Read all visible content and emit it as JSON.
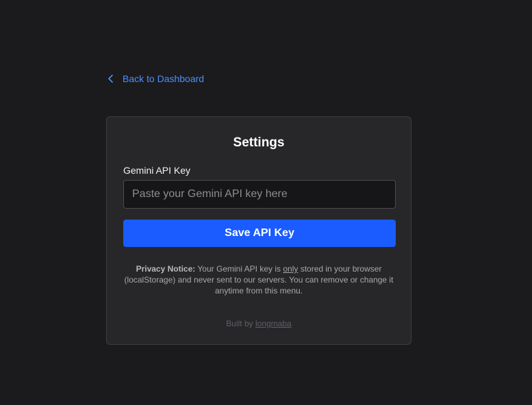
{
  "nav": {
    "back_label": "Back to Dashboard",
    "back_icon": "chevron-left-icon"
  },
  "settings": {
    "title": "Settings",
    "api_key_label": "Gemini API Key",
    "api_key_placeholder": "Paste your Gemini API key here",
    "api_key_value": "",
    "save_label": "Save API Key"
  },
  "privacy": {
    "heading": "Privacy Notice:",
    "text_before": " Your Gemini API key is ",
    "emphasis": "only",
    "text_after": " stored in your browser (localStorage) and never sent to our servers. You can remove or change it anytime from this menu."
  },
  "footer": {
    "built_by_prefix": "Built by ",
    "author": "longmaba"
  },
  "colors": {
    "background": "#1b1b1d",
    "card": "#27272a",
    "accent": "#1a5cff",
    "link": "#4c8dff"
  }
}
